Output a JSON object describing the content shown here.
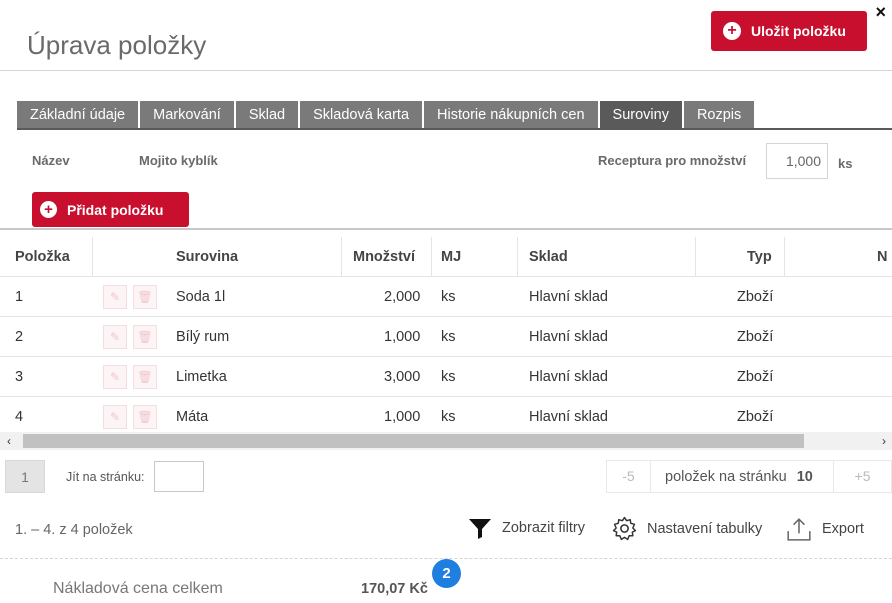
{
  "dialog": {
    "title": "Úprava položky",
    "close_glyph": "×",
    "save_label": "Uložit položku"
  },
  "tabs": [
    {
      "label": "Základní údaje",
      "active": false
    },
    {
      "label": "Markování",
      "active": false
    },
    {
      "label": "Sklad",
      "active": false
    },
    {
      "label": "Skladová karta",
      "active": false
    },
    {
      "label": "Historie nákupních cen",
      "active": false
    },
    {
      "label": "Suroviny",
      "active": true
    },
    {
      "label": "Rozpis",
      "active": false
    }
  ],
  "form": {
    "name_label": "Název",
    "name_value": "Mojito kyblík",
    "recipe_label": "Receptura pro množství",
    "recipe_value": "1,000",
    "recipe_unit": "ks",
    "add_item_label": "Přidat položku"
  },
  "grid": {
    "columns": [
      "Položka",
      "Surovina",
      "Množství",
      "MJ",
      "Sklad",
      "Typ",
      "N"
    ],
    "rows": [
      {
        "item": "1",
        "ingredient": "Soda 1l",
        "quantity": "2,000",
        "unit": "ks",
        "warehouse": "Hlavní sklad",
        "type": "Zboží"
      },
      {
        "item": "2",
        "ingredient": "Bílý rum",
        "quantity": "1,000",
        "unit": "ks",
        "warehouse": "Hlavní sklad",
        "type": "Zboží"
      },
      {
        "item": "3",
        "ingredient": "Limetka",
        "quantity": "3,000",
        "unit": "ks",
        "warehouse": "Hlavní sklad",
        "type": "Zboží"
      },
      {
        "item": "4",
        "ingredient": "Máta",
        "quantity": "1,000",
        "unit": "ks",
        "warehouse": "Hlavní sklad",
        "type": "Zboží"
      }
    ]
  },
  "pager": {
    "current_page": "1",
    "jump_label": "Jít na stránku:",
    "minus_label": "-5",
    "per_page_label": "položek na stránku",
    "per_page_value": "10",
    "plus_label": "+5",
    "count_text": "1. – 4. z 4 položek"
  },
  "toolbar": {
    "filters_label": "Zobrazit filtry",
    "settings_label": "Nastavení tabulky",
    "export_label": "Export"
  },
  "summary": {
    "badge_count": "2",
    "cost_label": "Nákladová cena celkem",
    "cost_value": "170,07 Kč"
  },
  "icons": {
    "close": "close-icon",
    "plus": "plus-circle-icon",
    "edit": "pencil-icon",
    "delete": "trash-icon",
    "filter": "filter-icon",
    "settings": "gear-icon",
    "export": "upload-icon"
  },
  "colors": {
    "accent": "#c8102e",
    "tab": "#7a7a7a",
    "tab_active": "#5a5a5a",
    "badge": "#1e7fe0"
  }
}
